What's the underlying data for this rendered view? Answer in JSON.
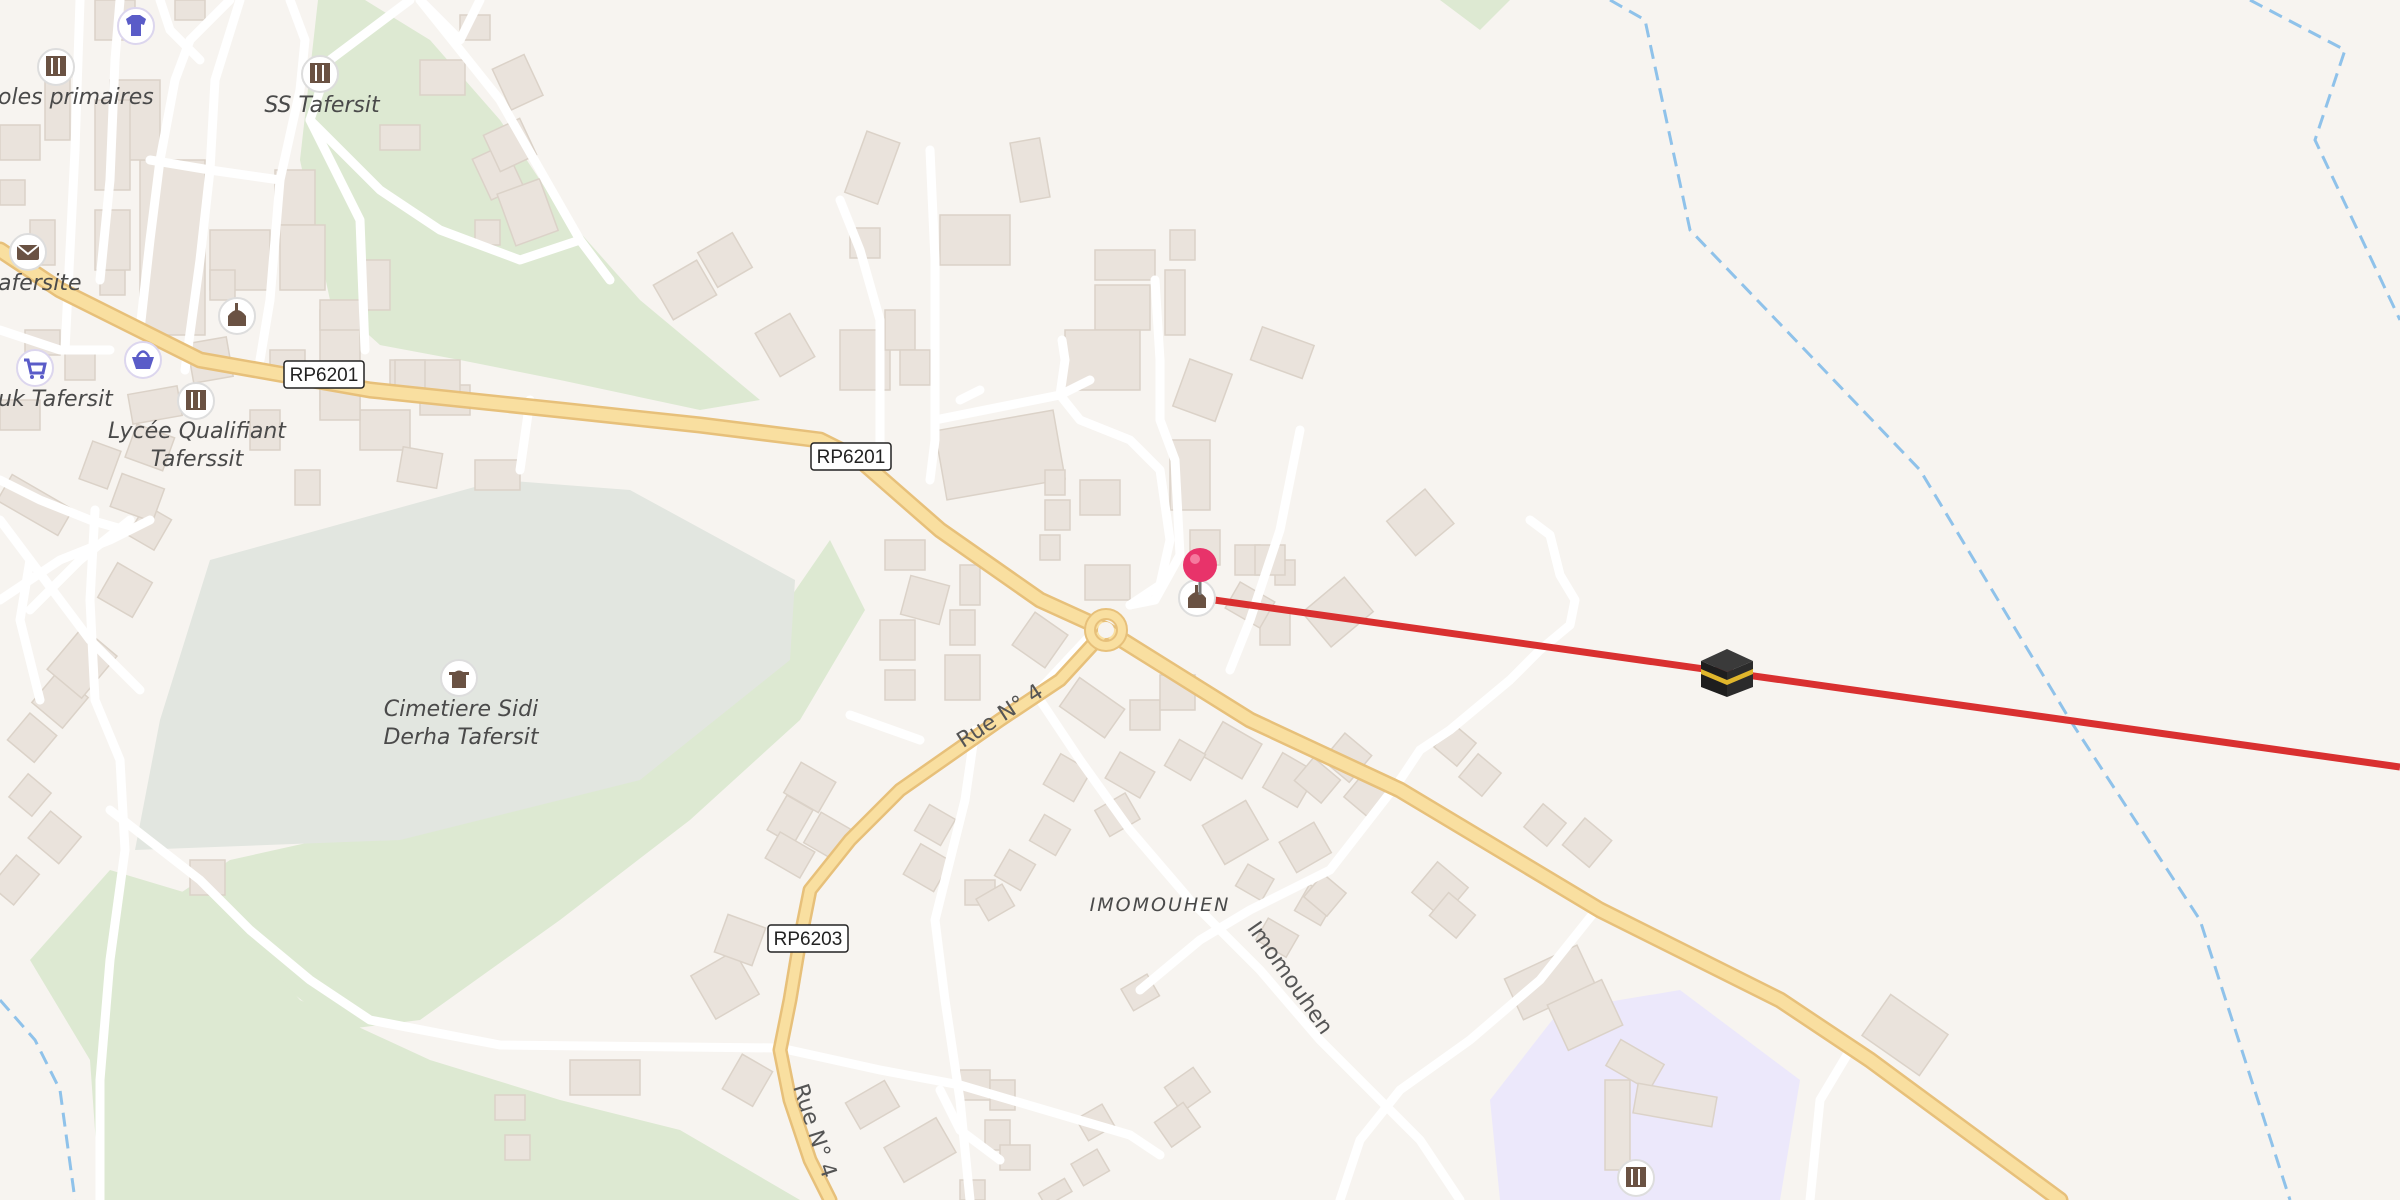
{
  "map": {
    "labels": {
      "ecoles_primaires": "oles primaires",
      "ss_tafersit": "SS Tafersit",
      "tafersite": "afersite",
      "souk_tafersit": "uk Tafersit",
      "lycee_line1": "Lycée Qualifiant",
      "lycee_line2": "Taferssit",
      "cemetery_line1": "Cimetiere Sidi",
      "cemetery_line2": "Derha Tafersit",
      "imomouhen_area": "IMOMOUHEN",
      "imomouhen_street": "Imomouhen",
      "rue_n4_a": "Rue N° 4",
      "rue_n4_b": "Rue N° 4"
    },
    "road_shields": {
      "rp6201_a": "RP6201",
      "rp6201_b": "RP6201",
      "rp6203": "RP6203"
    },
    "icons": {
      "clothes": "shirt-icon",
      "school": "school-icon",
      "post": "post-office-icon",
      "mosque": "mosque-icon",
      "shop": "shopping-cart-icon",
      "market": "shopping-basket-icon",
      "cemetery": "cemetery-icon",
      "kaaba": "kaaba-icon",
      "pin": "location-pin-icon"
    },
    "colors": {
      "background": "#f7f4f0",
      "main_road": "#f9dfa0",
      "main_road_casing": "#e7c07a",
      "minor_road": "#ffffff",
      "building": "#eae3dc",
      "park": "#dde9d2",
      "cemetery": "#e2e6e0",
      "school_area": "#ece8fb",
      "boundary": "#8fc2ea",
      "qibla_line": "#d93030",
      "pin": "#e8336a",
      "poi": "#6a5243",
      "shop_poi": "#5a5cc8"
    }
  }
}
